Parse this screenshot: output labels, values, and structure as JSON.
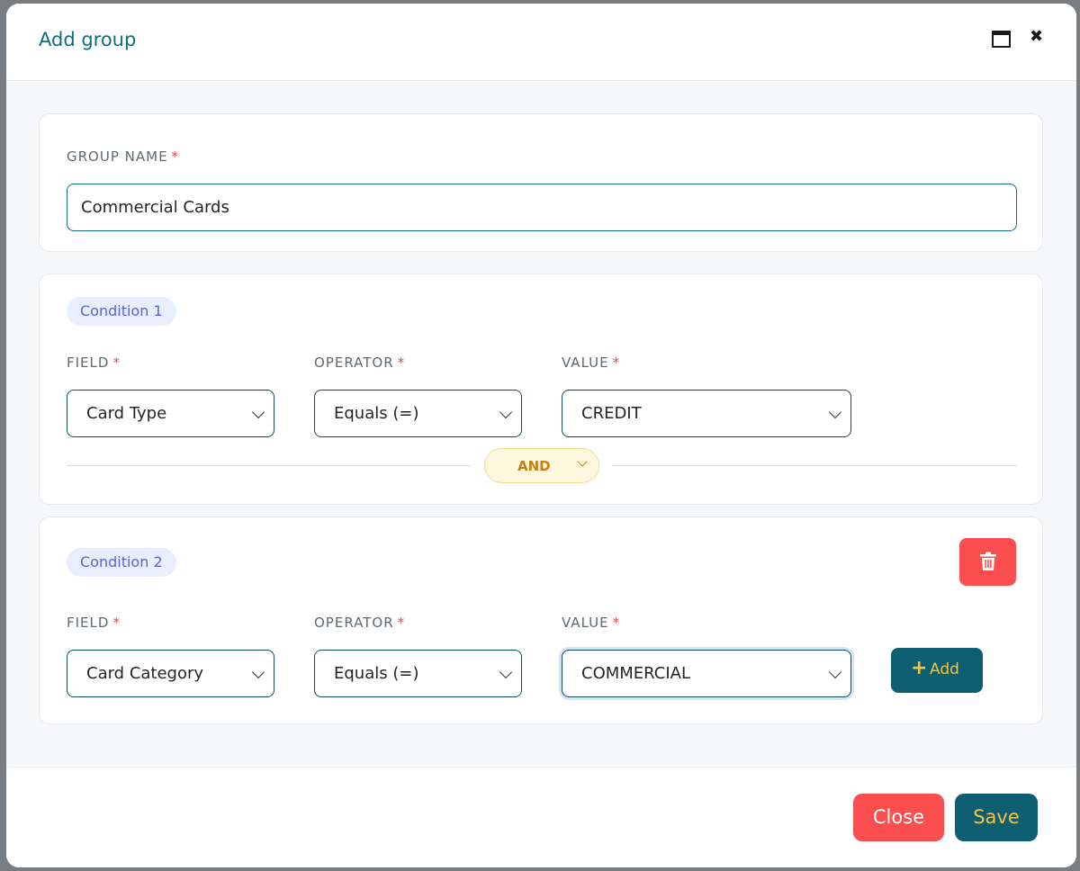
{
  "modal": {
    "title": "Add group"
  },
  "group_name": {
    "label": "GROUP NAME",
    "required_mark": "*",
    "value": "Commercial Cards"
  },
  "conditions": [
    {
      "pill": "Condition 1",
      "field_label": "FIELD",
      "operator_label": "OPERATOR",
      "value_label": "VALUE",
      "required_mark": "*",
      "field": "Card Type",
      "operator": "Equals (=)",
      "value": "CREDIT",
      "logic": "AND"
    },
    {
      "pill": "Condition 2",
      "field_label": "FIELD",
      "operator_label": "OPERATOR",
      "value_label": "VALUE",
      "required_mark": "*",
      "field": "Card Category",
      "operator": "Equals (=)",
      "value": "COMMERCIAL",
      "add_label": "Add"
    }
  ],
  "footer": {
    "close_label": "Close",
    "save_label": "Save"
  },
  "colors": {
    "accent": "#0e6e80",
    "danger": "#fb4f4f",
    "primary_button": "#0e5e72",
    "button_text_gold": "#f3c441",
    "pill_bg": "#e9eeff",
    "pill_text": "#5565d6",
    "logic_bg": "#fff7dd"
  }
}
